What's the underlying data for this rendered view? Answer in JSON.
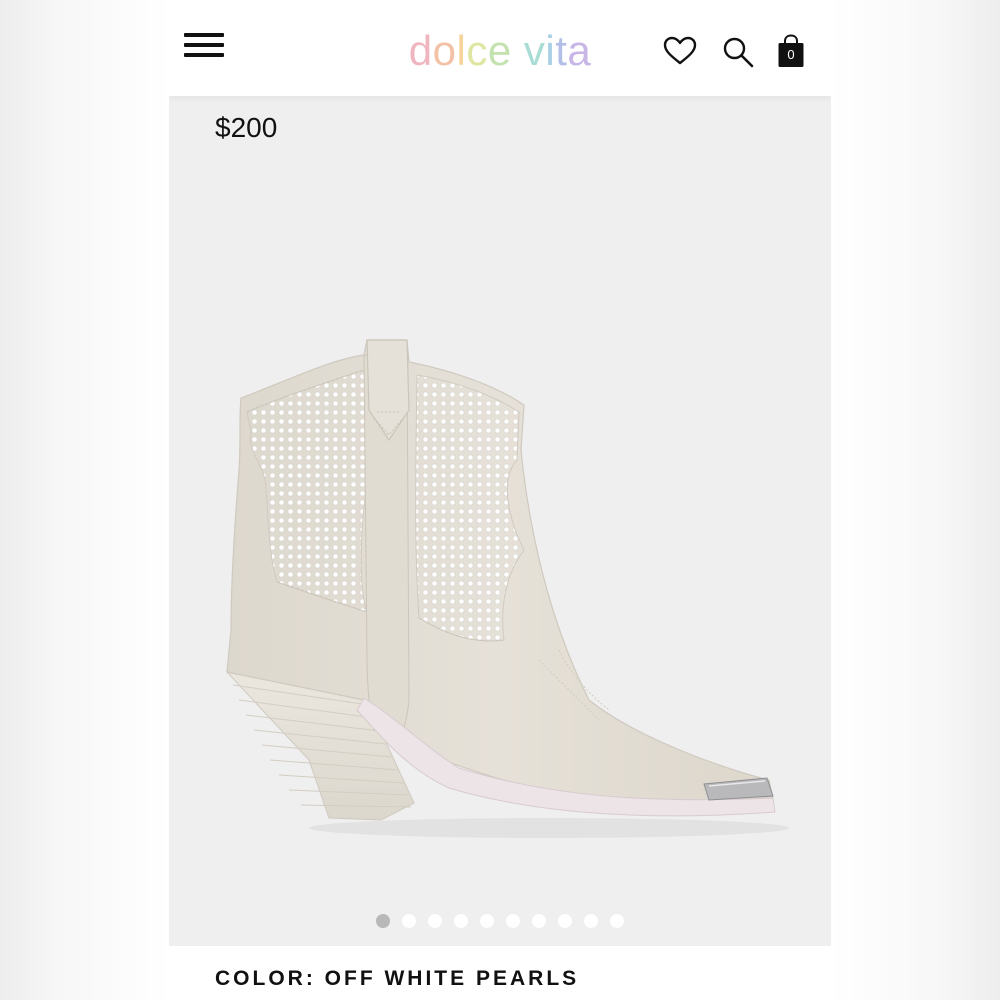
{
  "header": {
    "logo_text": "dolce vita",
    "logo_letters": [
      {
        "char": "d",
        "color": "#f0b6c0"
      },
      {
        "char": "o",
        "color": "#f3c1a6"
      },
      {
        "char": "l",
        "color": "#f4d49a"
      },
      {
        "char": "c",
        "color": "#dfe6a2"
      },
      {
        "char": "e",
        "color": "#c4e2b0"
      },
      {
        "char": " ",
        "color": "#ffffff"
      },
      {
        "char": "v",
        "color": "#a9dcd4"
      },
      {
        "char": "i",
        "color": "#a8cfe6"
      },
      {
        "char": "t",
        "color": "#b4bfe8"
      },
      {
        "char": "a",
        "color": "#c7b6e6"
      }
    ],
    "icons": [
      "menu-icon",
      "heart-icon",
      "search-icon",
      "shopping-bag-icon"
    ],
    "bag_count": "0"
  },
  "product": {
    "price": "$200",
    "image_alt": "off white pearl studded western ankle boot",
    "color_label": "COLOR: OFF WHITE PEARLS"
  },
  "carousel": {
    "total": 10,
    "active_index": 0
  },
  "colors": {
    "background": "#efefef",
    "header": "#ffffff",
    "boot": "#e4dfd5",
    "pearl_panel": "#f3f2ee",
    "dot_active": "#b8b8b8",
    "dot_inactive": "#ffffff"
  }
}
